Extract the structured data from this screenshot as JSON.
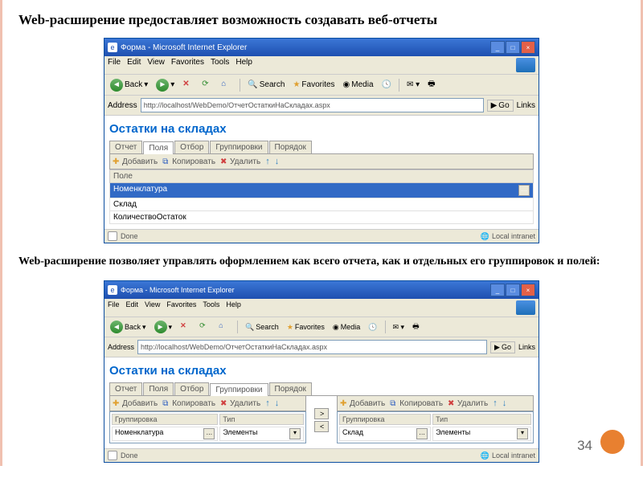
{
  "heading1": "Web-расширение предоставляет возможность создавать веб-отчеты",
  "heading2": "Web-расширение позволяет управлять оформлением как всего отчета, как и отдельных его группировок и полей:",
  "pageNumber": "34",
  "ie1": {
    "title": "Форма - Microsoft Internet Explorer",
    "menu": [
      "File",
      "Edit",
      "View",
      "Favorites",
      "Tools",
      "Help"
    ],
    "back": "Back",
    "search": "Search",
    "favorites": "Favorites",
    "media": "Media",
    "addressLabel": "Address",
    "addressValue": "http://localhost/WebDemo/ОтчетОстаткиНаСкладах.aspx",
    "go": "Go",
    "links": "Links",
    "pageTitle": "Остатки на складах",
    "tabs": [
      "Отчет",
      "Поля",
      "Отбор",
      "Группировки",
      "Порядок"
    ],
    "activeTab": 1,
    "actions": {
      "add": "Добавить",
      "copy": "Копировать",
      "del": "Удалить"
    },
    "colHeader": "Поле",
    "rows": [
      "Номенклатура",
      "Склад",
      "КоличествоОстаток"
    ],
    "selectedRow": 0,
    "statusDone": "Done",
    "statusZone": "Local intranet"
  },
  "ie2": {
    "title": "Форма - Microsoft Internet Explorer",
    "menu": [
      "File",
      "Edit",
      "View",
      "Favorites",
      "Tools",
      "Help"
    ],
    "back": "Back",
    "search": "Search",
    "favorites": "Favorites",
    "media": "Media",
    "addressLabel": "Address",
    "addressValue": "http://localhost/WebDemo/ОтчетОстаткиНаСкладах.aspx",
    "go": "Go",
    "links": "Links",
    "pageTitle": "Остатки на складах",
    "tabs": [
      "Отчет",
      "Поля",
      "Отбор",
      "Группировки",
      "Порядок"
    ],
    "activeTab": 3,
    "actions": {
      "add": "Добавить",
      "copy": "Копировать",
      "del": "Удалить"
    },
    "leftCols": [
      "Группировка",
      "Тип"
    ],
    "leftRow": [
      "Номенклатура",
      "Элементы"
    ],
    "rightCols": [
      "Группировка",
      "Тип"
    ],
    "rightRow": [
      "Склад",
      "Элементы"
    ],
    "statusDone": "Done",
    "statusZone": "Local intranet"
  }
}
